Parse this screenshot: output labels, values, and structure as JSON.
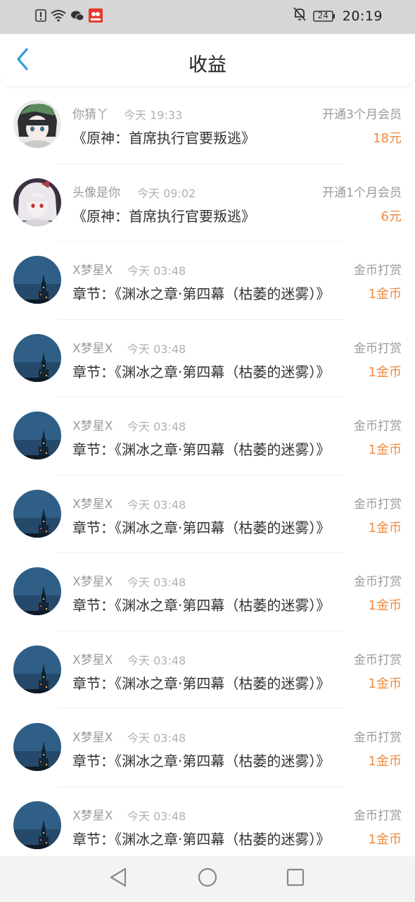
{
  "status_bar": {
    "time": "20:19",
    "battery": "24",
    "icons": [
      "alert-icon",
      "wifi-icon",
      "wechat-icon",
      "app-notification-icon",
      "bell-off-icon",
      "battery-icon"
    ]
  },
  "header": {
    "title": "收益",
    "back_icon": "chevron-left-icon"
  },
  "colors": {
    "accent": "#2a9be0",
    "amount": "#f08a3e",
    "muted": "#9a9a9a"
  },
  "items": [
    {
      "user": "你猜丫",
      "time": "今天 19:33",
      "type": "开通3个月会员",
      "desc": "《原神：首席执行官要叛逃》",
      "amount": "18元",
      "avatar": "anime-avatar-green"
    },
    {
      "user": "头像是你",
      "time": "今天 09:02",
      "type": "开通1个月会员",
      "desc": "《原神：首席执行官要叛逃》",
      "amount": "6元",
      "avatar": "anime-avatar-white"
    },
    {
      "user": "X梦星X",
      "time": "今天 03:48",
      "type": "金币打赏",
      "desc": "章节：《渊冰之章·第四幕（枯萎的迷雾）》",
      "amount": "1金币",
      "avatar": "night-tower-avatar"
    },
    {
      "user": "X梦星X",
      "time": "今天 03:48",
      "type": "金币打赏",
      "desc": "章节：《渊冰之章·第四幕（枯萎的迷雾）》",
      "amount": "1金币",
      "avatar": "night-tower-avatar"
    },
    {
      "user": "X梦星X",
      "time": "今天 03:48",
      "type": "金币打赏",
      "desc": "章节：《渊冰之章·第四幕（枯萎的迷雾）》",
      "amount": "1金币",
      "avatar": "night-tower-avatar"
    },
    {
      "user": "X梦星X",
      "time": "今天 03:48",
      "type": "金币打赏",
      "desc": "章节：《渊冰之章·第四幕（枯萎的迷雾）》",
      "amount": "1金币",
      "avatar": "night-tower-avatar"
    },
    {
      "user": "X梦星X",
      "time": "今天 03:48",
      "type": "金币打赏",
      "desc": "章节：《渊冰之章·第四幕（枯萎的迷雾）》",
      "amount": "1金币",
      "avatar": "night-tower-avatar"
    },
    {
      "user": "X梦星X",
      "time": "今天 03:48",
      "type": "金币打赏",
      "desc": "章节：《渊冰之章·第四幕（枯萎的迷雾）》",
      "amount": "1金币",
      "avatar": "night-tower-avatar"
    },
    {
      "user": "X梦星X",
      "time": "今天 03:48",
      "type": "金币打赏",
      "desc": "章节：《渊冰之章·第四幕（枯萎的迷雾）》",
      "amount": "1金币",
      "avatar": "night-tower-avatar"
    },
    {
      "user": "X梦星X",
      "time": "今天 03:48",
      "type": "金币打赏",
      "desc": "章节：《渊冰之章·第四幕（枯萎的迷雾）》",
      "amount": "1金币",
      "avatar": "night-tower-avatar"
    }
  ],
  "nav": {
    "icons": [
      "back-triangle-icon",
      "home-circle-icon",
      "recents-square-icon"
    ]
  }
}
